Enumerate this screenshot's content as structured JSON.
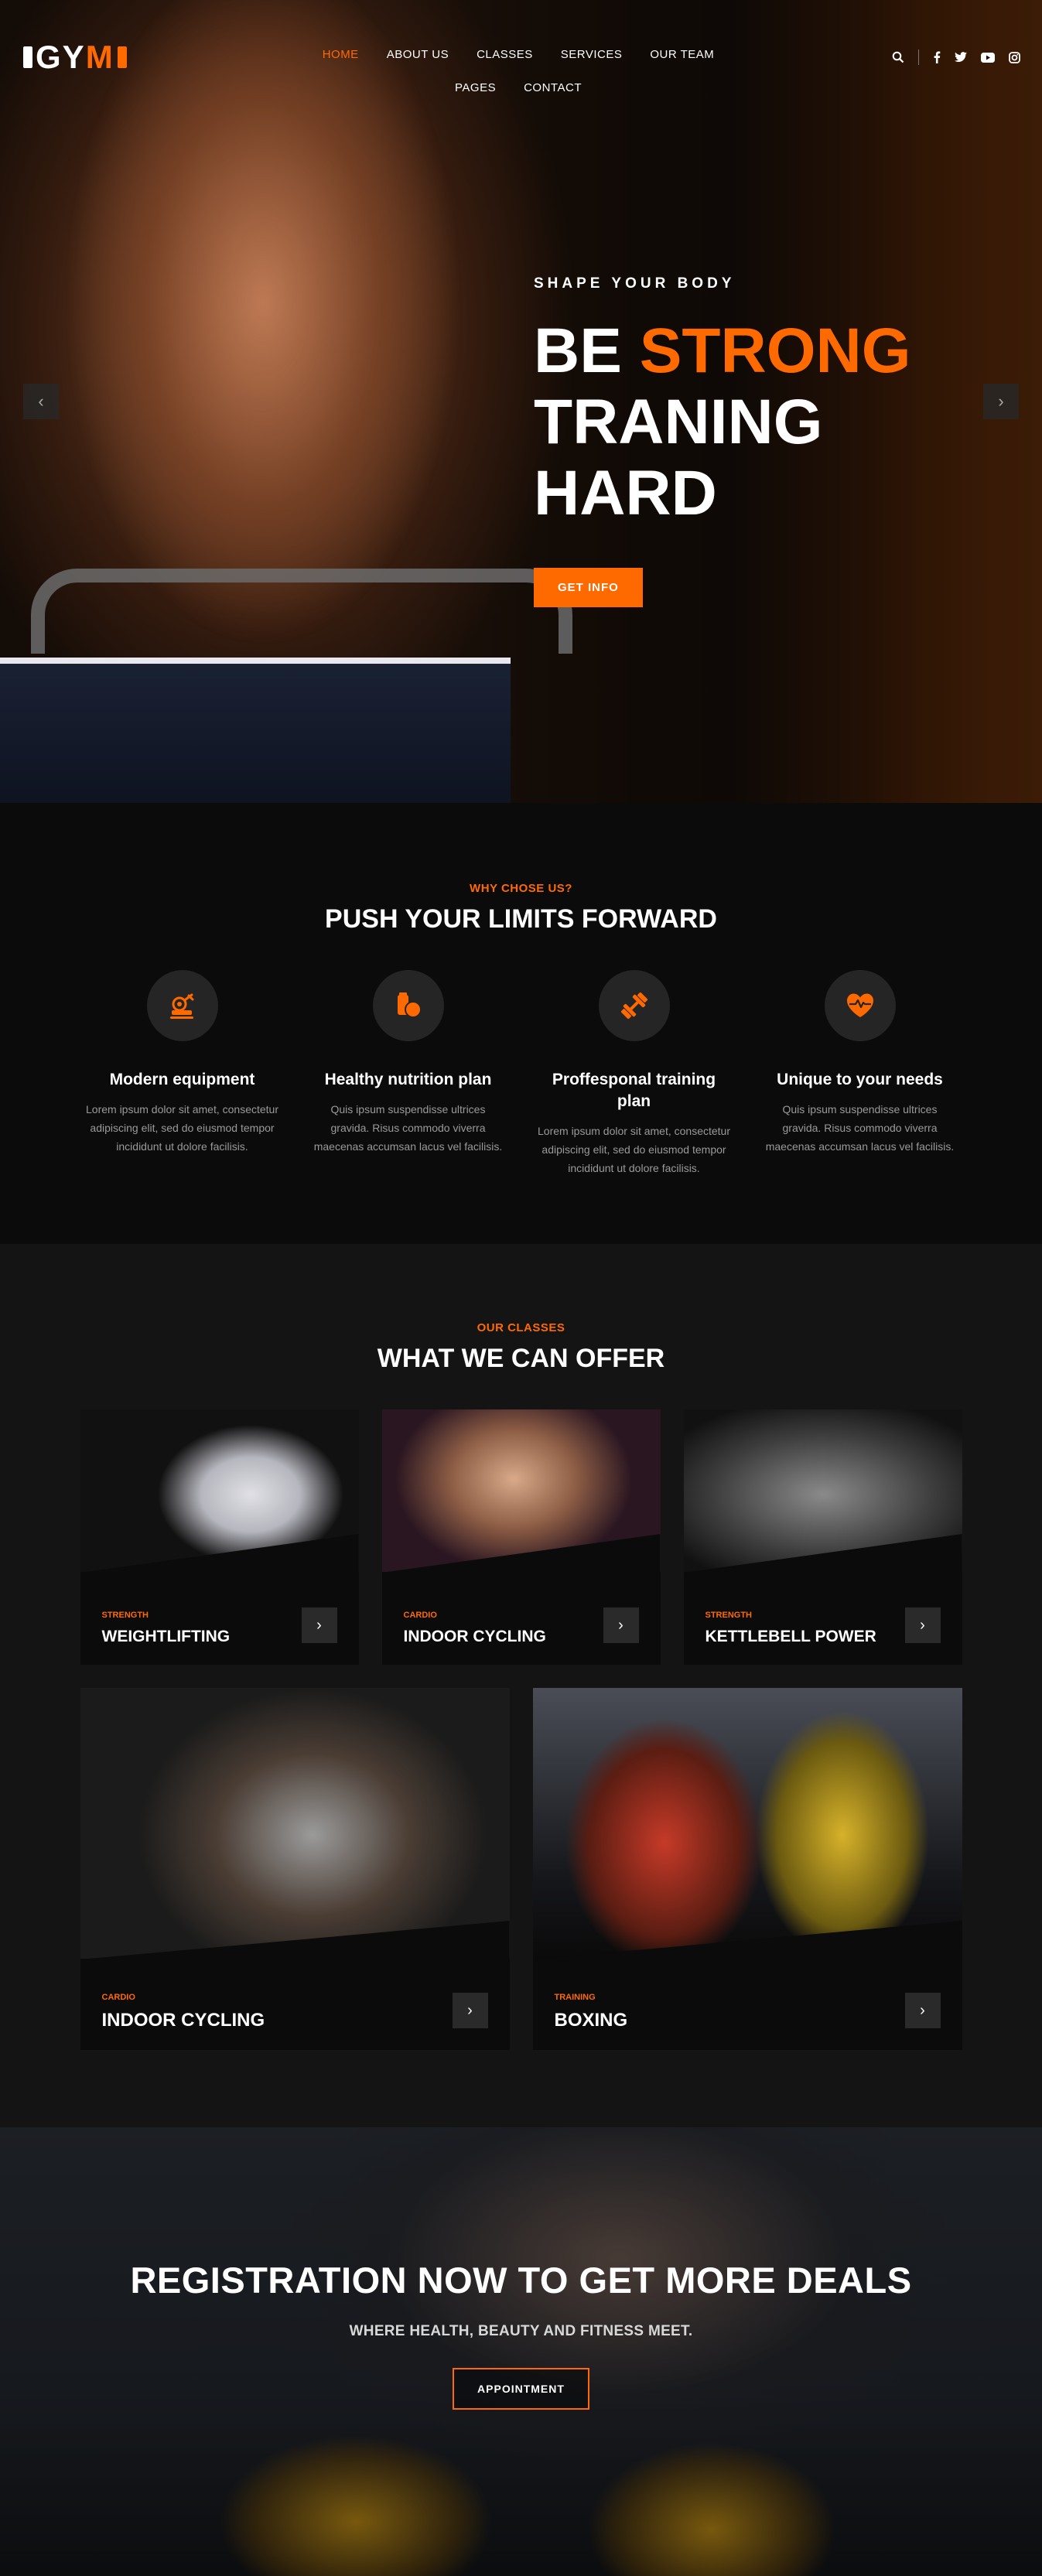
{
  "header": {
    "logo": {
      "left": "GY",
      "right": "M"
    },
    "nav": [
      "Home",
      "About Us",
      "Classes",
      "Services",
      "Our Team",
      "Pages",
      "Contact"
    ],
    "active_index": 0,
    "icons": [
      "search-icon",
      "facebook-icon",
      "twitter-icon",
      "youtube-icon",
      "instagram-icon"
    ]
  },
  "hero": {
    "subtitle": "SHAPE YOUR BODY",
    "title_line1_a": "BE",
    "title_line1_b": "STRONG",
    "title_line2": "TRANING",
    "title_line3": "HARD",
    "button": "GET INFO"
  },
  "why": {
    "kicker": "WHY CHOSE US?",
    "title": "PUSH YOUR LIMITS FORWARD",
    "features": [
      {
        "icon": "equipment-icon",
        "title": "Modern equipment",
        "text": "Lorem ipsum dolor sit amet, consectetur adipiscing elit, sed do eiusmod tempor incididunt ut dolore facilisis."
      },
      {
        "icon": "nutrition-icon",
        "title": "Healthy nutrition plan",
        "text": "Quis ipsum suspendisse ultrices gravida. Risus commodo viverra maecenas accumsan lacus vel facilisis."
      },
      {
        "icon": "dumbbell-icon",
        "title": "Proffesponal training plan",
        "text": "Lorem ipsum dolor sit amet, consectetur adipiscing elit, sed do eiusmod tempor incididunt ut dolore facilisis."
      },
      {
        "icon": "heart-icon",
        "title": "Unique to your needs",
        "text": "Quis ipsum suspendisse ultrices gravida. Risus commodo viverra maecenas accumsan lacus vel facilisis."
      }
    ]
  },
  "classes": {
    "kicker": "OUR CLASSES",
    "title": "WHAT WE CAN OFFER",
    "items": [
      {
        "category": "STRENGTH",
        "name": "WEIGHTLIFTING"
      },
      {
        "category": "CARDIO",
        "name": "INDOOR CYCLING"
      },
      {
        "category": "STRENGTH",
        "name": "KETTLEBELL POWER"
      },
      {
        "category": "CARDIO",
        "name": "INDOOR CYCLING"
      },
      {
        "category": "TRAINING",
        "name": "BOXING"
      }
    ]
  },
  "registration": {
    "title": "REGISTRATION NOW TO GET MORE DEALS",
    "subtitle": "WHERE HEALTH, BEAUTY AND FITNESS MEET.",
    "button": "APPOINTMENT"
  },
  "colors": {
    "accent": "#ff6a00",
    "dark": "#0b0b0b",
    "card": "#141414"
  }
}
